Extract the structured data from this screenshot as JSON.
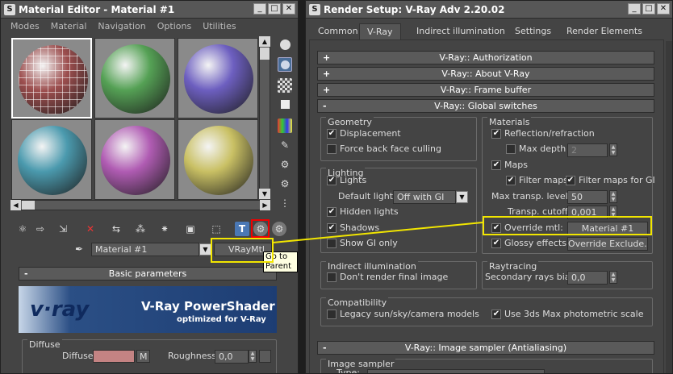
{
  "material_editor": {
    "title": "Material Editor - Material #1",
    "menu": [
      "Modes",
      "Material",
      "Navigation",
      "Options",
      "Utilities"
    ],
    "slot_colors": [
      "#9c4e4e",
      "#55a155",
      "#6d5fc0",
      "#4b9aae",
      "#b05cb3",
      "#c9c064"
    ],
    "active_slot": 1,
    "material_name": "Material #1",
    "material_type": "VRayMtl",
    "tooltip": "Go to Parent",
    "rollout_title": "Basic parameters",
    "banner_brand": "v·ray",
    "banner_title": "V-Ray PowerShader",
    "banner_subtitle": "optimized for V-Ray",
    "diffuse_group": "Diffuse",
    "diffuse_label": "Diffuse",
    "diffuse_map_btn": "M",
    "diffuse_color": "#c48383",
    "roughness_label": "Roughness",
    "roughness_value": "0,0"
  },
  "render_setup": {
    "title": "Render Setup: V-Ray Adv 2.20.02",
    "tabs": [
      "Common",
      "V-Ray",
      "Indirect illumination",
      "Settings",
      "Render Elements"
    ],
    "active_tab": "V-Ray",
    "rollouts": {
      "authorization": "V-Ray:: Authorization",
      "about": "V-Ray:: About V-Ray",
      "frame_buffer": "V-Ray:: Frame buffer",
      "global_switches": "V-Ray:: Global switches",
      "image_sampler": "V-Ray:: Image sampler (Antialiasing)"
    },
    "geometry": {
      "title": "Geometry",
      "displacement": "Displacement",
      "force_back_face": "Force back face culling"
    },
    "lighting": {
      "title": "Lighting",
      "lights": "Lights",
      "default_lights_label": "Default lights",
      "default_lights_value": "Off with GI",
      "hidden_lights": "Hidden lights",
      "shadows": "Shadows",
      "show_gi_only": "Show GI only"
    },
    "indirect": {
      "title": "Indirect illumination",
      "dont_render": "Don't render final image"
    },
    "compatibility": {
      "title": "Compatibility",
      "legacy": "Legacy sun/sky/camera models",
      "photometric": "Use 3ds Max photometric scale"
    },
    "materials": {
      "title": "Materials",
      "reflection": "Reflection/refraction",
      "max_depth_label": "Max depth",
      "max_depth_value": "2",
      "maps": "Maps",
      "filter_maps": "Filter maps",
      "filter_maps_gi": "Filter maps for GI",
      "max_transp_label": "Max transp. levels",
      "max_transp_value": "50",
      "transp_cutoff_label": "Transp. cutoff",
      "transp_cutoff_value": "0,001",
      "override_mtl": "Override mtl:",
      "override_mtl_value": "Material #1",
      "glossy": "Glossy effects",
      "override_exclude": "Override Exclude..."
    },
    "raytracing": {
      "title": "Raytracing",
      "secondary_bias_label": "Secondary rays bias",
      "secondary_bias_value": "0,0"
    },
    "image_sampler_group": "Image sampler",
    "type_label": "Type:"
  }
}
